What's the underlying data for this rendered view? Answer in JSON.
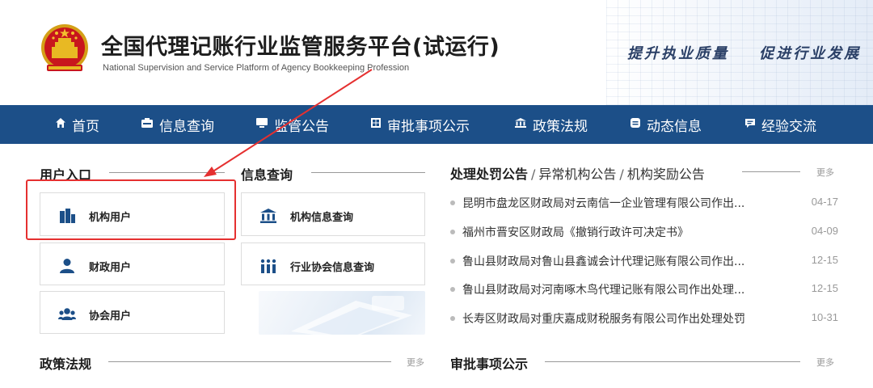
{
  "header": {
    "title": "全国代理记账行业监管服务平台(试运行)",
    "subtitle": "National Supervision and Service Platform of Agency Bookkeeping  Profession",
    "slogan": "提升执业质量    促进行业发展"
  },
  "nav": [
    {
      "label": "首页",
      "icon": "home-icon"
    },
    {
      "label": "信息查询",
      "icon": "id-card-icon"
    },
    {
      "label": "监管公告",
      "icon": "monitor-icon"
    },
    {
      "label": "审批事项公示",
      "icon": "grid-icon"
    },
    {
      "label": "政策法规",
      "icon": "bank-icon"
    },
    {
      "label": "动态信息",
      "icon": "list-icon"
    },
    {
      "label": "经验交流",
      "icon": "chat-icon"
    }
  ],
  "user_entry": {
    "title": "用户入口",
    "cards": [
      {
        "label": "机构用户",
        "icon": "building-icon"
      },
      {
        "label": "财政用户",
        "icon": "user-icon"
      },
      {
        "label": "协会用户",
        "icon": "group-icon"
      }
    ]
  },
  "info_query": {
    "title": "信息查询",
    "cards": [
      {
        "label": "机构信息查询",
        "icon": "bank-icon"
      },
      {
        "label": "行业协会信息查询",
        "icon": "stats-icon"
      }
    ]
  },
  "notices": {
    "tabs": [
      "处理处罚公告",
      "异常机构公告",
      "机构奖励公告"
    ],
    "separator": "/",
    "more": "更多",
    "items": [
      {
        "text": "昆明市盘龙区财政局对云南信一企业管理有限公司作出...",
        "date": "04-17"
      },
      {
        "text": "福州市晋安区财政局《撤销行政许可决定书》",
        "date": "04-09"
      },
      {
        "text": "鲁山县财政局对鲁山县鑫诚会计代理记账有限公司作出...",
        "date": "12-15"
      },
      {
        "text": "鲁山县财政局对河南啄木鸟代理记账有限公司作出处理...",
        "date": "12-15"
      },
      {
        "text": "长寿区财政局对重庆嘉成财税服务有限公司作出处理处罚",
        "date": "10-31"
      }
    ]
  },
  "policy": {
    "title": "政策法规",
    "more": "更多"
  },
  "approval": {
    "title": "审批事项公示",
    "more": "更多"
  },
  "colors": {
    "nav_bg": "#1c4f88",
    "highlight": "#e53030",
    "icon_blue": "#1c4f88"
  }
}
